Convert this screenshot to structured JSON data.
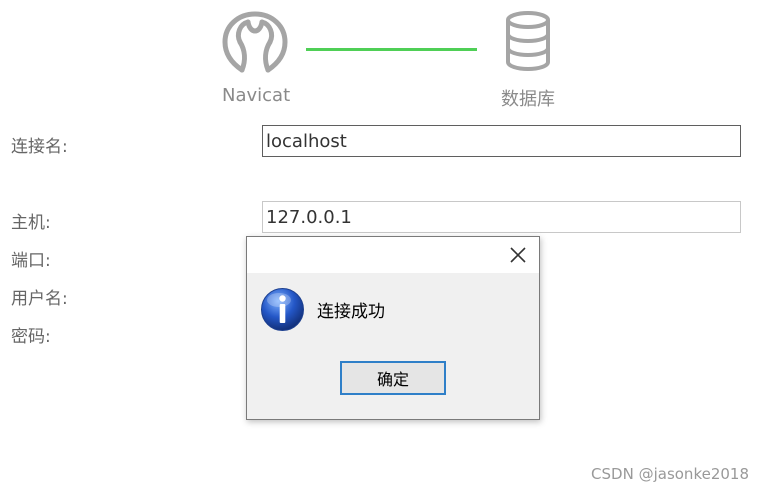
{
  "header": {
    "left_caption": "Navicat",
    "right_caption": "数据库",
    "left_icon": "navicat-logo-icon",
    "right_icon": "database-icon",
    "connector_color": "#4fcf56"
  },
  "form": {
    "connection_name_label": "连接名:",
    "connection_name_value": "localhost",
    "host_label": "主机:",
    "host_value": "127.0.0.1",
    "port_label": "端口:",
    "username_label": "用户名:",
    "password_label": "密码:"
  },
  "dialog": {
    "icon": "info-icon",
    "close_icon": "close-icon",
    "message": "连接成功",
    "ok_label": "确定"
  },
  "watermark": "CSDN @jasonke2018"
}
